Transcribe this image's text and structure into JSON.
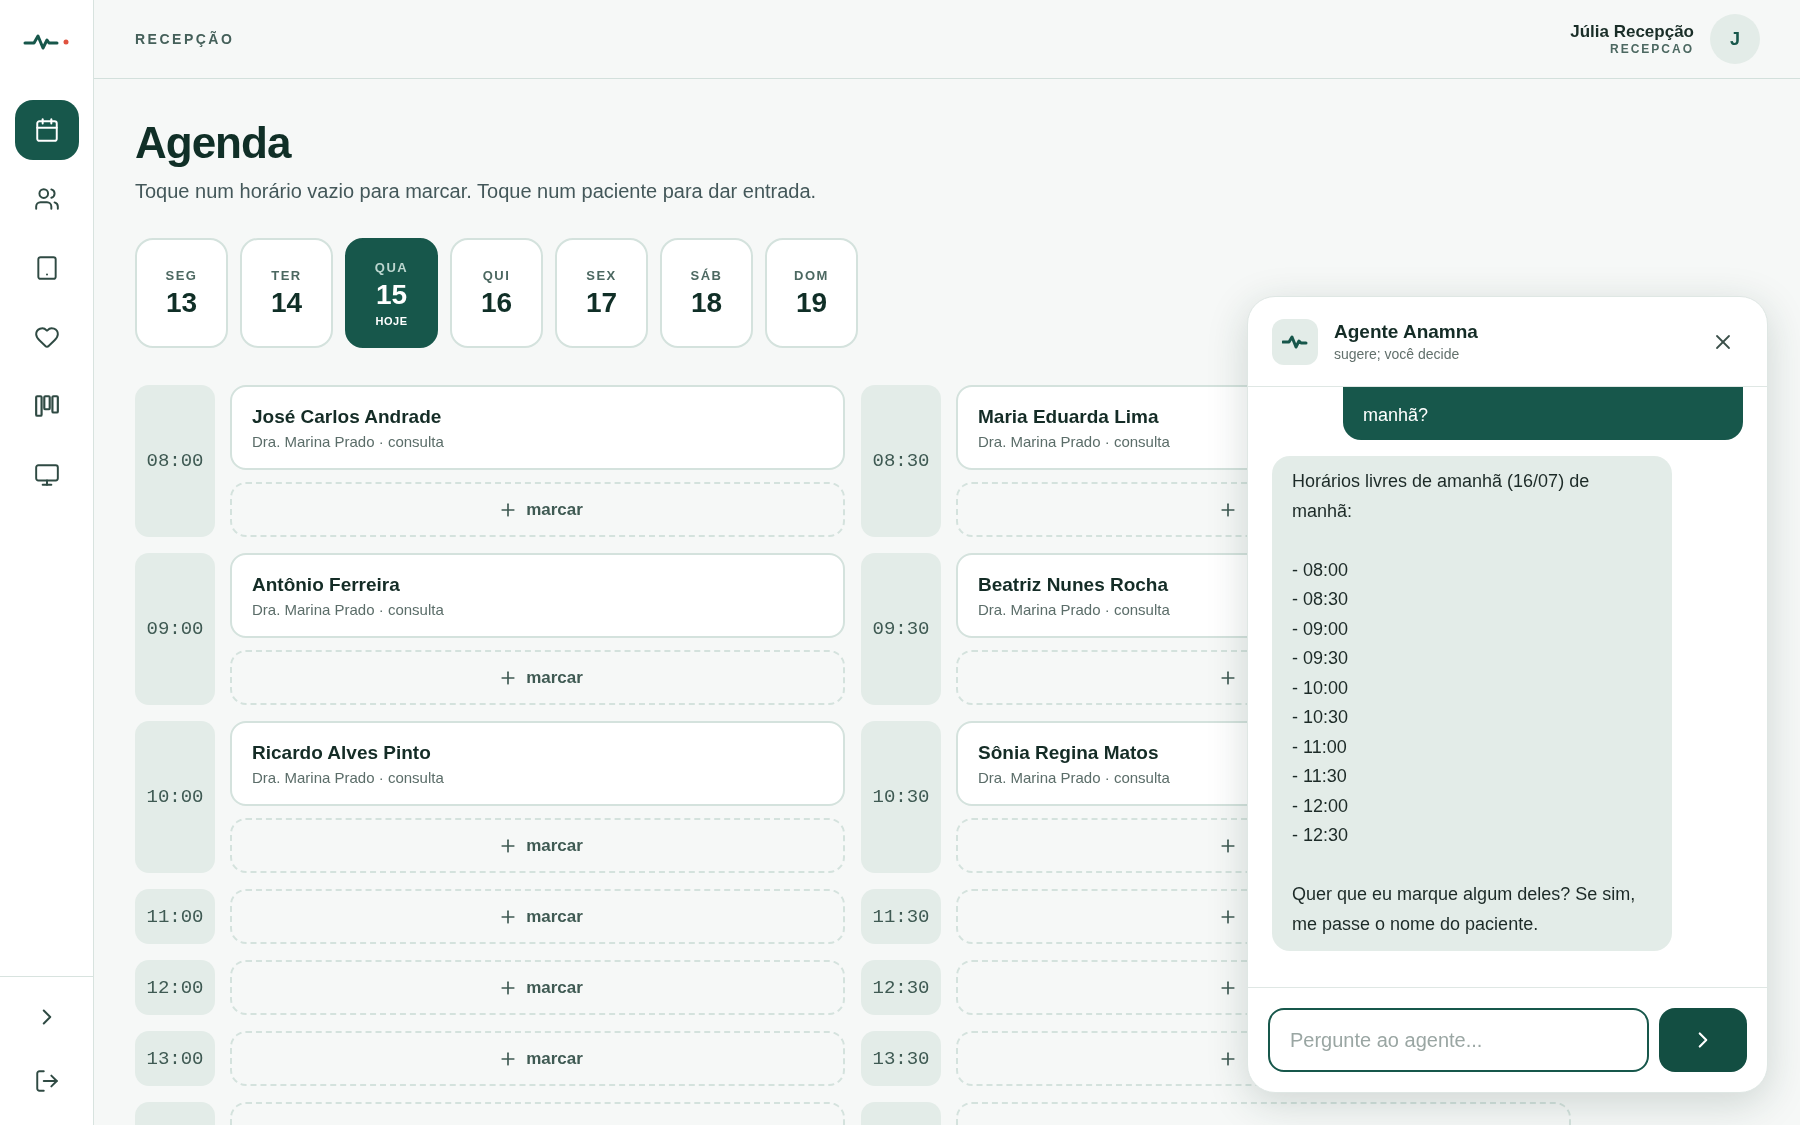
{
  "header": {
    "section": "RECEPÇÃO",
    "user": {
      "name": "Júlia Recepção",
      "role": "RECEPCAO",
      "initial": "J"
    }
  },
  "sidebar": {
    "items": [
      {
        "kind": "calendar",
        "selected": true
      },
      {
        "kind": "users",
        "selected": false
      },
      {
        "kind": "tablet",
        "selected": false
      },
      {
        "kind": "heart",
        "selected": false
      },
      {
        "kind": "board",
        "selected": false
      },
      {
        "kind": "monitor",
        "selected": false
      }
    ],
    "footer": [
      {
        "kind": "expand"
      },
      {
        "kind": "logout"
      }
    ]
  },
  "page": {
    "title": "Agenda",
    "subtitle": "Toque num horário vazio para marcar. Toque num paciente para dar entrada."
  },
  "days": [
    {
      "weekday": "SEG",
      "day": "13",
      "selected": false
    },
    {
      "weekday": "TER",
      "day": "14",
      "selected": false
    },
    {
      "weekday": "QUA",
      "day": "15",
      "badge": "HOJE",
      "selected": true
    },
    {
      "weekday": "QUI",
      "day": "16",
      "selected": false
    },
    {
      "weekday": "SEX",
      "day": "17",
      "selected": false
    },
    {
      "weekday": "SÁB",
      "day": "18",
      "selected": false
    },
    {
      "weekday": "DOM",
      "day": "19",
      "selected": false
    }
  ],
  "schedule": {
    "columns": [
      {
        "rows": [
          {
            "time": "08:00",
            "slots": [
              {
                "kind": "appointment",
                "patient": "José Carlos Andrade",
                "detail": "Dra. Marina Prado · consulta"
              },
              {
                "kind": "empty",
                "label": "marcar"
              }
            ]
          },
          {
            "time": "09:00",
            "slots": [
              {
                "kind": "appointment",
                "patient": "Antônio Ferreira",
                "detail": "Dra. Marina Prado · consulta"
              },
              {
                "kind": "empty",
                "label": "marcar"
              }
            ]
          },
          {
            "time": "10:00",
            "slots": [
              {
                "kind": "appointment",
                "patient": "Ricardo Alves Pinto",
                "detail": "Dra. Marina Prado · consulta"
              },
              {
                "kind": "empty",
                "label": "marcar"
              }
            ]
          },
          {
            "time": "11:00",
            "slots": [
              {
                "kind": "empty",
                "label": "marcar"
              }
            ]
          },
          {
            "time": "12:00",
            "slots": [
              {
                "kind": "empty",
                "label": "marcar"
              }
            ]
          },
          {
            "time": "13:00",
            "slots": [
              {
                "kind": "empty",
                "label": "marcar"
              }
            ]
          },
          {
            "slots": [
              {
                "kind": "empty"
              }
            ]
          }
        ]
      },
      {
        "rows": [
          {
            "time": "08:30",
            "slots": [
              {
                "kind": "appointment",
                "patient": "Maria Eduarda Lima",
                "detail": "Dra. Marina Prado · consulta"
              },
              {
                "kind": "empty"
              }
            ]
          },
          {
            "time": "09:30",
            "slots": [
              {
                "kind": "appointment",
                "patient": "Beatriz Nunes Rocha",
                "detail": "Dra. Marina Prado · consulta"
              },
              {
                "kind": "empty"
              }
            ]
          },
          {
            "time": "10:30",
            "slots": [
              {
                "kind": "appointment",
                "patient": "Sônia Regina Matos",
                "detail": "Dra. Marina Prado · consulta"
              },
              {
                "kind": "empty"
              }
            ]
          },
          {
            "time": "11:30",
            "slots": [
              {
                "kind": "empty"
              }
            ]
          },
          {
            "time": "12:30",
            "slots": [
              {
                "kind": "empty"
              }
            ]
          },
          {
            "time": "13:30",
            "slots": [
              {
                "kind": "empty"
              }
            ]
          },
          {
            "slots": [
              {
                "kind": "empty"
              }
            ]
          }
        ]
      }
    ]
  },
  "chat": {
    "title": "Agente Anamna",
    "subtitle": "sugere; você decide",
    "messages": [
      {
        "kind": "user",
        "text": "manhã?"
      },
      {
        "kind": "agent",
        "text": "Horários livres de amanhã (16/07) de manhã:\n\n- 08:00\n- 08:30\n- 09:00\n- 09:30\n- 10:00\n- 10:30\n- 11:00\n- 11:30\n- 12:00\n- 12:30\n\nQuer que eu marque algum deles? Se sim, me passe o nome do paciente."
      }
    ],
    "input": {
      "placeholder": "Pergunte ao agente..."
    }
  }
}
